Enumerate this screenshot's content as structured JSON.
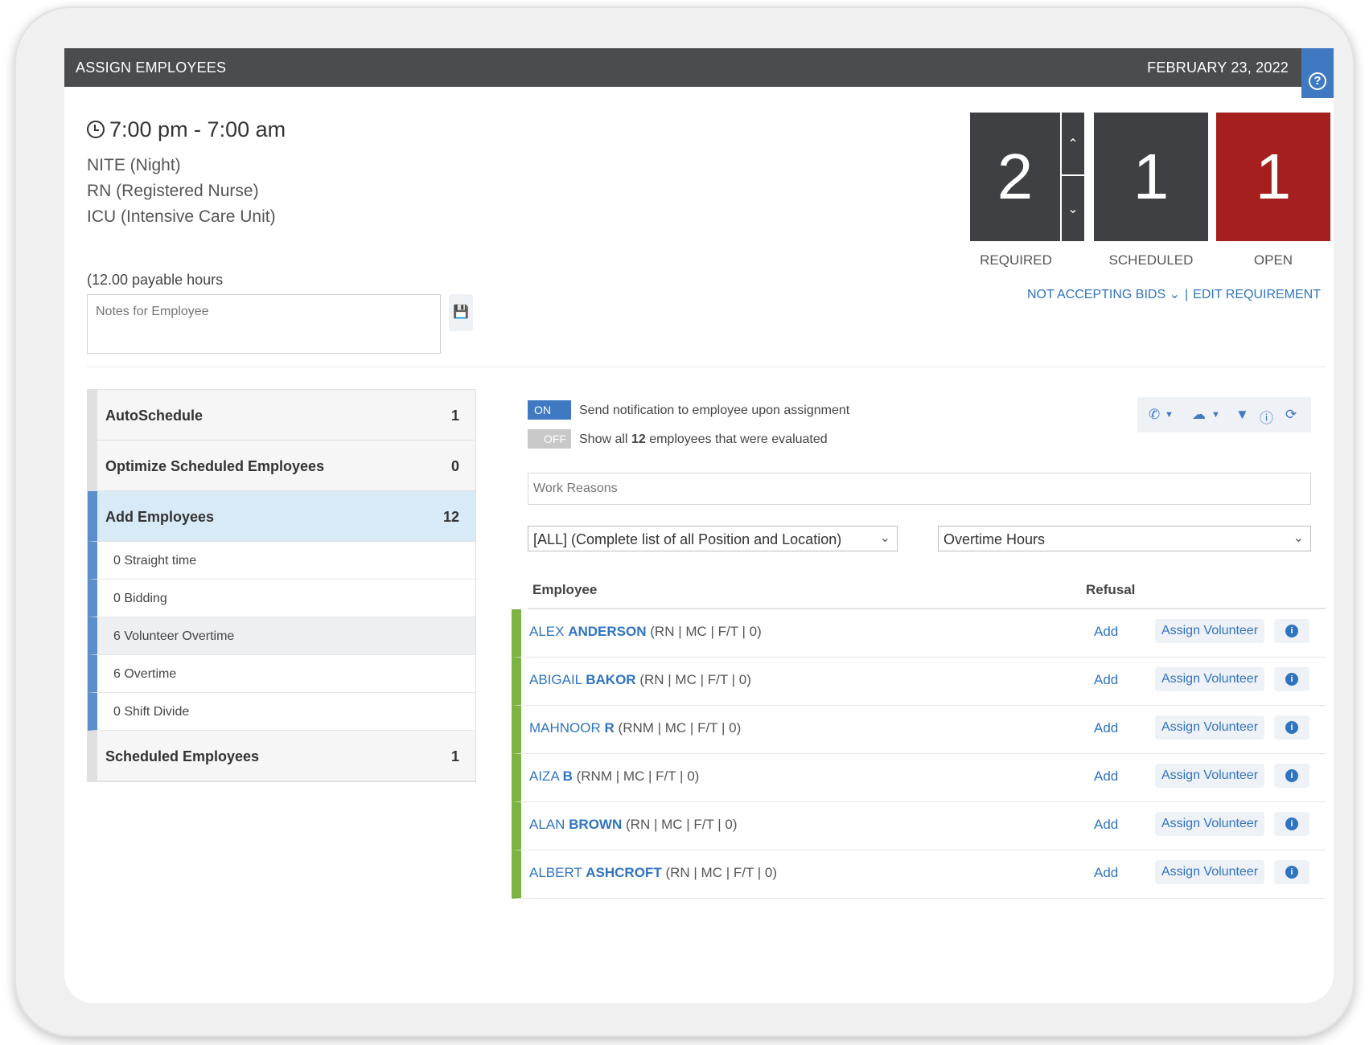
{
  "header": {
    "title": "ASSIGN EMPLOYEES",
    "date": "FEBRUARY 23, 2022",
    "help_symbol": "?"
  },
  "shift": {
    "time": "7:00 pm - 7:00 am",
    "shift_name": "NITE (Night)",
    "position": "RN (Registered Nurse)",
    "unit": "ICU (Intensive Care Unit)",
    "payable": "(12.00 payable hours",
    "notes_placeholder": "Notes for Employee"
  },
  "counters": {
    "required": {
      "value": "2",
      "label": "REQUIRED"
    },
    "scheduled": {
      "value": "1",
      "label": "SCHEDULED"
    },
    "open": {
      "value": "1",
      "label": "OPEN"
    },
    "open_color": "#a51f1f"
  },
  "links": {
    "bids": "NOT ACCEPTING BIDS",
    "edit": "EDIT REQUIREMENT",
    "separator": "|"
  },
  "sidebar": {
    "autoschedule": {
      "label": "AutoSchedule",
      "count": "1"
    },
    "optimize": {
      "label": "Optimize Scheduled Employees",
      "count": "0"
    },
    "add": {
      "label": "Add Employees",
      "count": "12"
    },
    "sub": [
      "0 Straight time",
      "0 Bidding",
      "6 Volunteer Overtime",
      "6 Overtime",
      "0 Shift Divide"
    ],
    "scheduled": {
      "label": "Scheduled Employees",
      "count": "1"
    }
  },
  "toggles": {
    "on_label": "ON",
    "off_label": "OFF",
    "notify_text": "Send notification to employee upon assignment",
    "show_prefix": "Show all",
    "show_count": "12",
    "show_suffix": "employees that were evaluated"
  },
  "filters": {
    "work_reasons_placeholder": "Work Reasons",
    "position_select": "[ALL] (Complete list of all Position and Location)",
    "sort_select": "Overtime Hours"
  },
  "table": {
    "headers": {
      "employee": "Employee",
      "refusal": "Refusal"
    },
    "add_label": "Add",
    "assign_label": "Assign Volunteer",
    "rows": [
      {
        "first": "ALEX",
        "last": "ANDERSON",
        "meta": "(RN | MC | F/T | 0)"
      },
      {
        "first": "ABIGAIL",
        "last": "BAKOR",
        "meta": "(RN | MC | F/T | 0)"
      },
      {
        "first": "MAHNOOR",
        "last": "R",
        "meta": "(RNM | MC | F/T | 0)"
      },
      {
        "first": "AIZA",
        "last": "B",
        "meta": "(RNM | MC | F/T | 0)"
      },
      {
        "first": "ALAN",
        "last": "BROWN",
        "meta": "(RN | MC | F/T | 0)"
      },
      {
        "first": "ALBERT",
        "last": "ASHCROFT",
        "meta": "(RN | MC | F/T | 0)"
      }
    ]
  }
}
